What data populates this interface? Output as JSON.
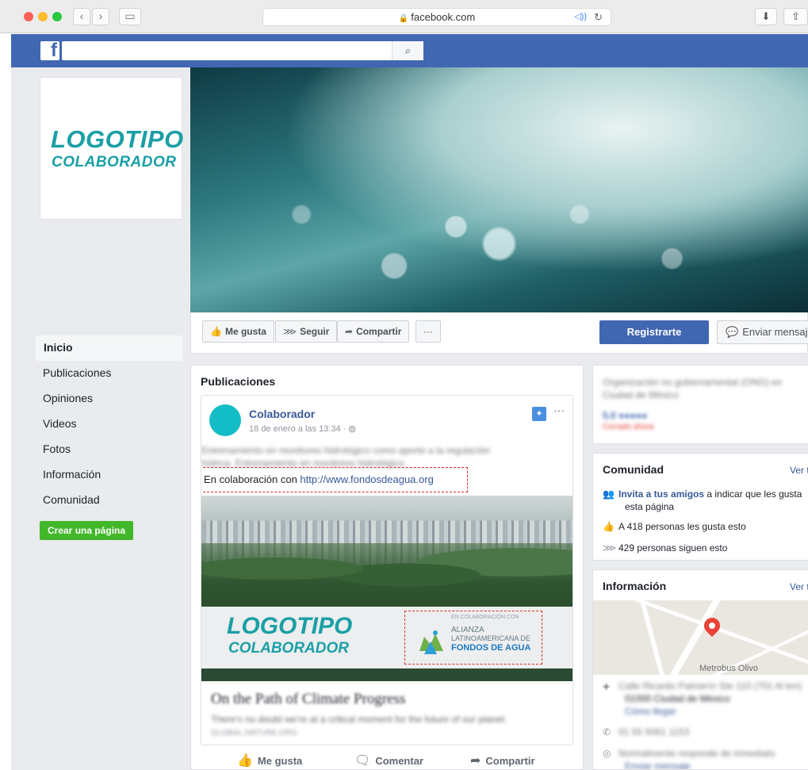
{
  "browser": {
    "url": "facebook.com",
    "back": "‹",
    "forward": "›",
    "sound": "◁))",
    "reload": "↻",
    "download": "⬇",
    "share": "⇧"
  },
  "fb": {
    "logo": "f",
    "search_placeholder": "",
    "search_icon": "⌕"
  },
  "page": {
    "profile_logo_line1": "LOGOTIPO",
    "profile_logo_line2": "COLABORADOR",
    "actions": {
      "like": "Me gusta",
      "follow": "Seguir",
      "share": "Compartir",
      "more": "···",
      "register": "Registrarte",
      "message": "Enviar mensaje"
    },
    "nav": [
      {
        "label": "Inicio",
        "active": true
      },
      {
        "label": "Publicaciones",
        "active": false
      },
      {
        "label": "Opiniones",
        "active": false
      },
      {
        "label": "Videos",
        "active": false
      },
      {
        "label": "Fotos",
        "active": false
      },
      {
        "label": "Información",
        "active": false
      },
      {
        "label": "Comunidad",
        "active": false
      }
    ],
    "create_page": "Crear una página"
  },
  "posts": {
    "title": "Publicaciones",
    "post": {
      "author": "Colaborador",
      "date": "18 de enero a las 13:34 · ◍",
      "more": "···",
      "pin": "📌",
      "text_line1": "Entrenamiento en monitoreo hidrológico como aporte a la regulación",
      "text_line2": "hídrica. Entrenamiento en monitoreo hidrológico.",
      "collab_prefix": "En colaboración con ",
      "collab_link": "http://www.fondosdeagua.org",
      "banner_line1": "LOGOTIPO",
      "banner_line2": "COLABORADOR",
      "alianza_small": "EN COLABORACIÓN CON",
      "alianza_l1": "ALIANZA",
      "alianza_l2": "LATINOAMERICANA DE",
      "alianza_l3": "FONDOS DE AGUA",
      "link_title": "On the Path of Climate Progress",
      "link_desc": "There's no doubt we're at a critical moment for the future of our planet.",
      "link_domain": "GLOBAL.NATURE.ORG",
      "footer_like": "Me gusta",
      "footer_comment": "Comentar",
      "footer_share": "Compartir"
    }
  },
  "right": {
    "about_line1": "Organización no gubernamental (ONG) en",
    "about_line2": "Ciudad de México",
    "rating": "5.0 ●●●●●",
    "status": "Cerrado ahora",
    "community": {
      "title": "Comunidad",
      "see_all": "Ver t",
      "invite_bold": "Invita a tus amigos",
      "invite_rest": " a indicar que les gusta",
      "invite_line2": "esta página",
      "likes": "A 418 personas les gusta esto",
      "follows": "429 personas siguen esto"
    },
    "info": {
      "title": "Información",
      "see_all": "Ver t",
      "map_label": "Metrobus Olivo",
      "address1": "Calle Ricardo Palmerín Ste 110 (701 Al km)",
      "address2": "01000 Ciudad de México",
      "directions": "Cómo llegar",
      "phone": "01 55 5061 1153",
      "response1": "Normalmente responde de inmediato",
      "response2": "Enviar mensaje"
    }
  }
}
